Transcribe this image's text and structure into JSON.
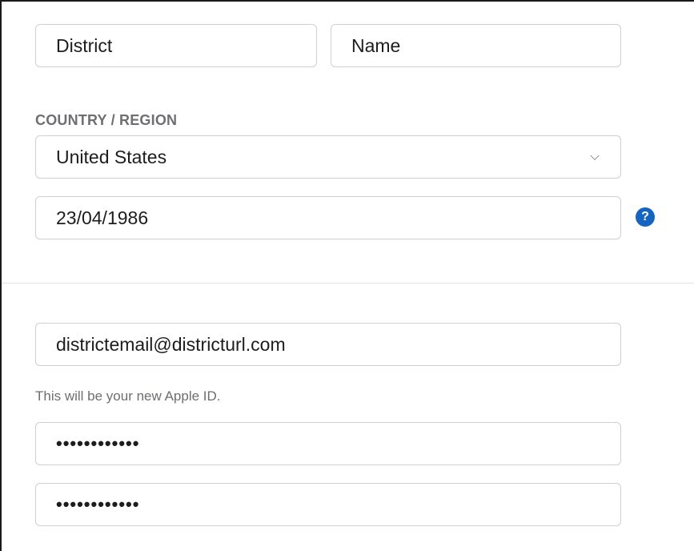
{
  "name_row": {
    "first_field": {
      "value": "District"
    },
    "last_field": {
      "value": "Name"
    }
  },
  "country": {
    "label": "COUNTRY / REGION",
    "selected": "United States",
    "chevron_icon": "chevron-down-icon"
  },
  "birthday": {
    "value": "23/04/1986",
    "help_icon": "question-mark-icon",
    "help_glyph": "?",
    "help_color": "#1565c0"
  },
  "email": {
    "value": "districtemail@districturl.com",
    "hint": "This will be your new Apple ID."
  },
  "password": {
    "value": "••••••••••••"
  },
  "confirm_password": {
    "value": "••••••••••••"
  }
}
